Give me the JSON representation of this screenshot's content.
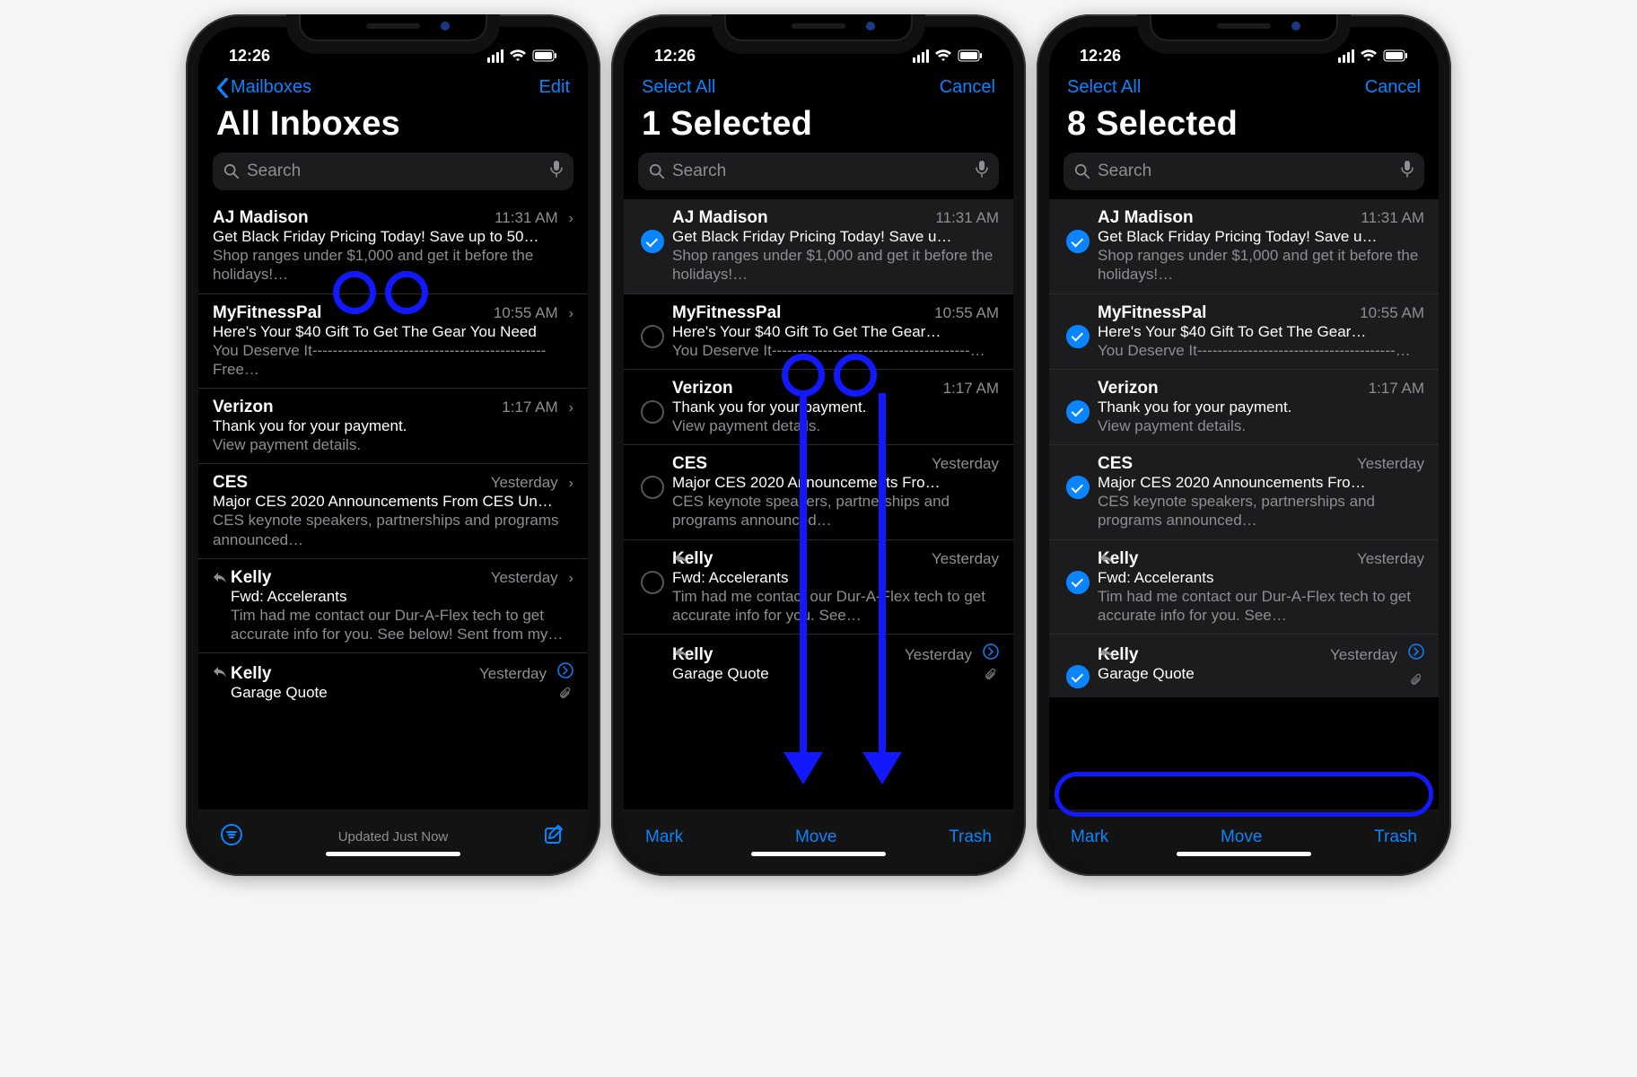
{
  "status": {
    "time": "12:26"
  },
  "colors": {
    "ios_blue": "#0a84ff",
    "highlight": "#1219ff"
  },
  "search": {
    "placeholder": "Search"
  },
  "phone1": {
    "nav": {
      "back": "Mailboxes",
      "right": "Edit"
    },
    "title": "All Inboxes",
    "toolbar": {
      "status": "Updated Just Now"
    }
  },
  "phone2": {
    "nav": {
      "left": "Select All",
      "right": "Cancel"
    },
    "title": "1 Selected",
    "toolbar": {
      "left": "Mark",
      "center": "Move",
      "right": "Trash"
    }
  },
  "phone3": {
    "nav": {
      "left": "Select All",
      "right": "Cancel"
    },
    "title": "8 Selected",
    "toolbar": {
      "left": "Mark",
      "center": "Move",
      "right": "Trash"
    }
  },
  "emails": [
    {
      "sender": "AJ Madison",
      "time": "11:31 AM",
      "subject_full": "Get Black Friday Pricing Today! Save up to 50…",
      "subject_sel": "Get Black Friday Pricing Today! Save u…",
      "preview_full": "Shop ranges under $1,000 and get it before the holidays!…",
      "preview_sel": "Shop ranges under $1,000 and get it before the holidays!…",
      "reply": false
    },
    {
      "sender": "MyFitnessPal",
      "time": "10:55 AM",
      "subject_full": "Here's Your $40 Gift To Get The Gear You Need",
      "subject_sel": "Here's Your $40 Gift To Get The Gear…",
      "preview_full": "You Deserve It---------------------------------------------- Free…",
      "preview_sel": "You Deserve It---------------------------------------…",
      "reply": false
    },
    {
      "sender": "Verizon",
      "time": "1:17 AM",
      "subject_full": "Thank you for your payment.",
      "subject_sel": "Thank you for your payment.",
      "preview_full": "View payment details.",
      "preview_sel": "View payment details.",
      "reply": false
    },
    {
      "sender": "CES",
      "time": "Yesterday",
      "subject_full": "Major CES 2020 Announcements From CES Un…",
      "subject_sel": "Major CES 2020 Announcements Fro…",
      "preview_full": "CES keynote speakers, partnerships and programs announced…",
      "preview_sel": "CES keynote speakers, partnerships and programs announced…",
      "reply": false
    },
    {
      "sender": "Kelly",
      "time": "Yesterday",
      "subject_full": "Fwd: Accelerants",
      "subject_sel": "Fwd: Accelerants",
      "preview_full": "Tim had me contact our Dur-A-Flex tech to get accurate info for you. See below! Sent from my…",
      "preview_sel": "Tim had me contact our Dur-A-Flex tech to get accurate info for you. See…",
      "reply": true
    },
    {
      "sender": "Kelly",
      "time": "Yesterday",
      "subject_full": "Garage Quote",
      "subject_sel": "Garage Quote",
      "preview_full": "",
      "preview_sel": "",
      "reply": true,
      "thread": true,
      "attachment": true
    }
  ]
}
